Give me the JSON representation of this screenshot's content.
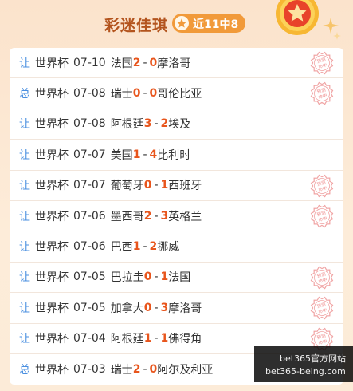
{
  "header": {
    "title": "彩迷佳琪",
    "record": "近11中8",
    "colors": {
      "title": "#b3541e",
      "badge": "#f19a3a",
      "score": "#e8551c",
      "kind": "#4a8fe0"
    }
  },
  "matches": [
    {
      "kind": "让",
      "league": "世界杯",
      "date": "07-10",
      "home": "法国",
      "home_score": "2",
      "away_score": "0",
      "away": "摩洛哥",
      "hit": true
    },
    {
      "kind": "总",
      "league": "世界杯",
      "date": "07-08",
      "home": "瑞士",
      "home_score": "0",
      "away_score": "0",
      "away": "哥伦比亚",
      "hit": true
    },
    {
      "kind": "让",
      "league": "世界杯",
      "date": "07-08",
      "home": "阿根廷",
      "home_score": "3",
      "away_score": "2",
      "away": "埃及",
      "hit": false
    },
    {
      "kind": "让",
      "league": "世界杯",
      "date": "07-07",
      "home": "美国",
      "home_score": "1",
      "away_score": "4",
      "away": "比利时",
      "hit": false
    },
    {
      "kind": "让",
      "league": "世界杯",
      "date": "07-07",
      "home": "葡萄牙",
      "home_score": "0",
      "away_score": "1",
      "away": "西班牙",
      "hit": true
    },
    {
      "kind": "让",
      "league": "世界杯",
      "date": "07-06",
      "home": "墨西哥",
      "home_score": "2",
      "away_score": "3",
      "away": "英格兰",
      "hit": true
    },
    {
      "kind": "让",
      "league": "世界杯",
      "date": "07-06",
      "home": "巴西",
      "home_score": "1",
      "away_score": "2",
      "away": "挪威",
      "hit": false
    },
    {
      "kind": "让",
      "league": "世界杯",
      "date": "07-05",
      "home": "巴拉圭",
      "home_score": "0",
      "away_score": "1",
      "away": "法国",
      "hit": true
    },
    {
      "kind": "让",
      "league": "世界杯",
      "date": "07-05",
      "home": "加拿大",
      "home_score": "0",
      "away_score": "3",
      "away": "摩洛哥",
      "hit": true
    },
    {
      "kind": "让",
      "league": "世界杯",
      "date": "07-04",
      "home": "阿根廷",
      "home_score": "1",
      "away_score": "1",
      "away": "佛得角",
      "hit": true
    },
    {
      "kind": "总",
      "league": "世界杯",
      "date": "07-03",
      "home": "瑞士",
      "home_score": "2",
      "away_score": "0",
      "away": "阿尔及利亚",
      "hit": false
    }
  ],
  "stamp_text": [
    "预测",
    "命中"
  ],
  "watermark": {
    "line1": "bet365官方网站",
    "line2": "bet365-being.com"
  }
}
